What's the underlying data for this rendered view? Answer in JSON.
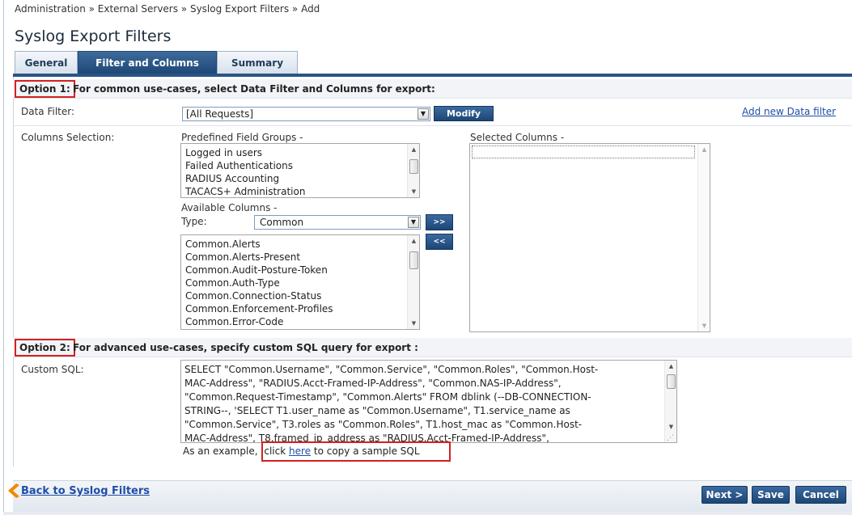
{
  "breadcrumb": "Administration » External Servers » Syslog Export Filters » Add",
  "page_title": "Syslog Export Filters",
  "tabs": [
    {
      "label": "General"
    },
    {
      "label": "Filter and Columns"
    },
    {
      "label": "Summary"
    }
  ],
  "option1": {
    "tag": "Option 1:",
    "text": "For common use-cases, select Data Filter and Columns for export:"
  },
  "data_filter": {
    "label": "Data Filter:",
    "value": "[All Requests]",
    "modify_label": "Modify",
    "add_new_label": "Add new Data filter"
  },
  "columns": {
    "label": "Columns Selection:",
    "predefined_label": "Predefined Field Groups -",
    "predefined_items": [
      "Logged in users",
      "Failed Authentications",
      "RADIUS Accounting",
      "TACACS+ Administration"
    ],
    "selected_label": "Selected Columns -",
    "available_label": "Available Columns -",
    "type_label": "Type:",
    "type_value": "Common",
    "add_button": ">>",
    "remove_button": "<<",
    "available_items": [
      "Common.Alerts",
      "Common.Alerts-Present",
      "Common.Audit-Posture-Token",
      "Common.Auth-Type",
      "Common.Connection-Status",
      "Common.Enforcement-Profiles",
      "Common.Error-Code"
    ]
  },
  "option2": {
    "tag": "Option 2:",
    "text": "For advanced use-cases, specify custom SQL query for export :"
  },
  "custom_sql": {
    "label": "Custom SQL:",
    "lines": [
      "SELECT \"Common.Username\", \"Common.Service\", \"Common.Roles\", \"Common.Host-",
      "MAC-Address\", \"RADIUS.Acct-Framed-IP-Address\", \"Common.NAS-IP-Address\",",
      "\"Common.Request-Timestamp\", \"Common.Alerts\" FROM dblink (--DB-CONNECTION-",
      "STRING--, 'SELECT T1.user_name as \"Common.Username\", T1.service_name as",
      "\"Common.Service\", T3.roles as \"Common.Roles\", T1.host_mac as \"Common.Host-",
      "MAC-Address\", T8.framed_ip_address as \"RADIUS.Acct-Framed-IP-Address\","
    ],
    "example_prefix": "As an example,",
    "example_click": "click",
    "example_link": "here",
    "example_suffix": "to copy a sample SQL"
  },
  "footer": {
    "back_label": "Back to Syslog Filters",
    "next_label": "Next >",
    "save_label": "Save",
    "cancel_label": "Cancel"
  },
  "colors": {
    "accent": "#1e4876",
    "highlight_box": "#d42020",
    "back_arrow": "#f08a00"
  },
  "icons": [
    "back-arrow-icon",
    "dropdown-arrow-icon",
    "scroll-up-icon",
    "scroll-down-icon",
    "resize-grip-icon"
  ]
}
